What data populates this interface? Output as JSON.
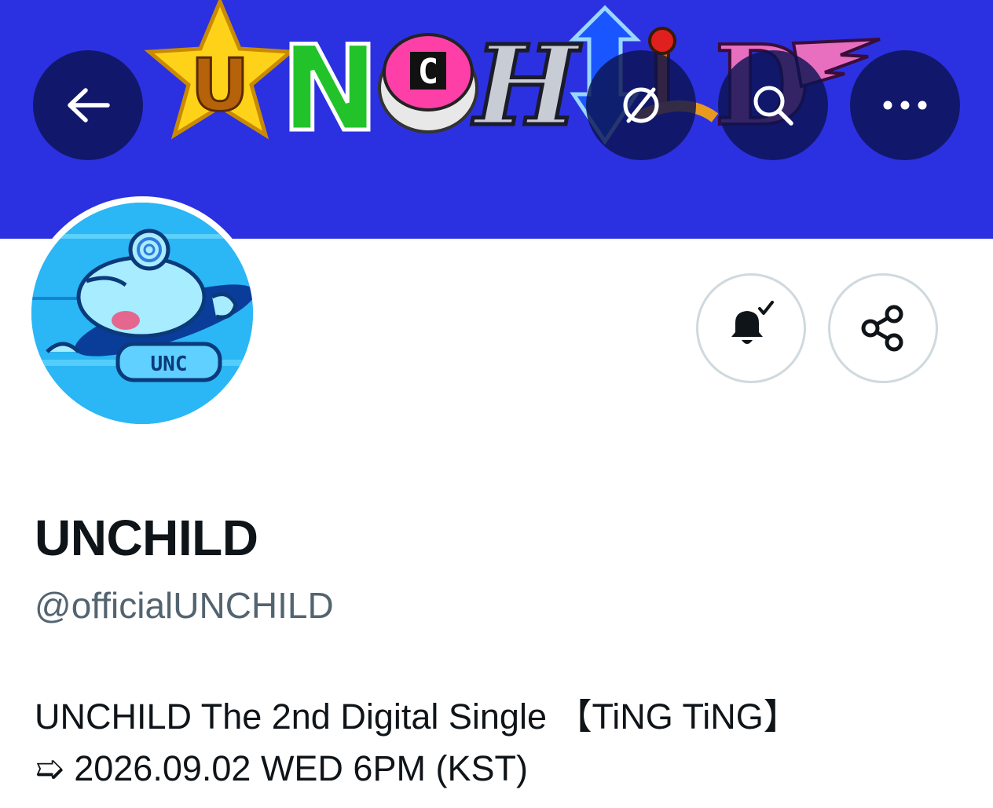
{
  "banner": {
    "logo_text": "UNCHILD",
    "background_color": "#2b31e0"
  },
  "nav": {
    "back_icon": "arrow-left-icon",
    "timeline_icon": "timeline-off-icon",
    "search_icon": "search-icon",
    "more_icon": "more-horizontal-icon"
  },
  "actions": {
    "notify_icon": "bell-subscribed-icon",
    "share_icon": "share-icon"
  },
  "profile": {
    "display_name": "UNCHILD",
    "handle": "@officialUNCHILD",
    "bio_line1": "UNCHILD The 2nd Digital Single 【TiNG TiNG】",
    "bio_line2_arrow": "➯",
    "bio_line2_text": " 2026.09.02 WED 6PM (KST)"
  },
  "colors": {
    "text_primary": "#0f1419",
    "text_secondary": "#536471",
    "button_border": "#cfd9de"
  }
}
